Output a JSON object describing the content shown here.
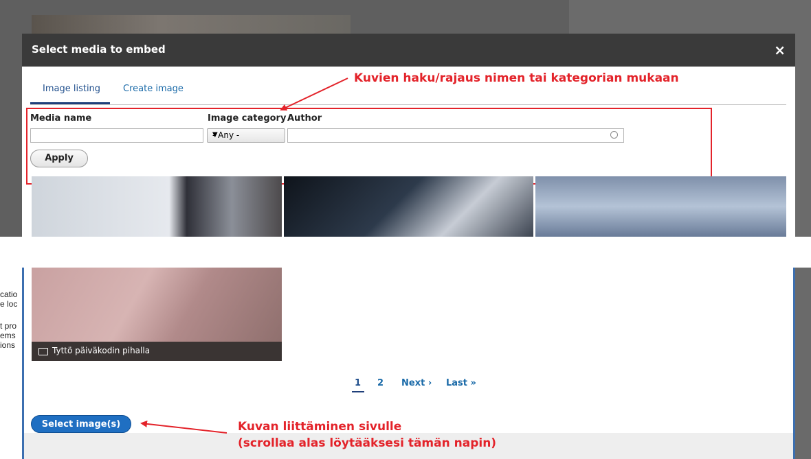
{
  "dialog": {
    "title": "Select media to embed",
    "close_icon": "×"
  },
  "tabs": [
    {
      "label": "Image listing",
      "active": true
    },
    {
      "label": "Create image",
      "active": false
    }
  ],
  "filters": {
    "media_name_label": "Media name",
    "media_name_value": "",
    "image_category_label": "Image category",
    "image_category_selected": "- Any -",
    "author_label": "Author",
    "author_value": "",
    "apply_label": "Apply"
  },
  "annotations": {
    "filter_note": "Kuvien haku/rajaus nimen tai kategorian mukaan",
    "select_note_line1": "Kuvan liittäminen sivulle",
    "select_note_line2": "(scrollaa alas löytääksesi tämän napin)",
    "color": "#e3232a"
  },
  "media_card": {
    "caption": "Tyttö päiväkodin pihalla"
  },
  "pager": {
    "pages": [
      "1",
      "2"
    ],
    "current": "1",
    "next": "Next ›",
    "last": "Last »"
  },
  "select_button": "Select image(s)",
  "background_text": [
    "catio",
    "e loc",
    "t pro",
    "ems",
    "ions"
  ]
}
